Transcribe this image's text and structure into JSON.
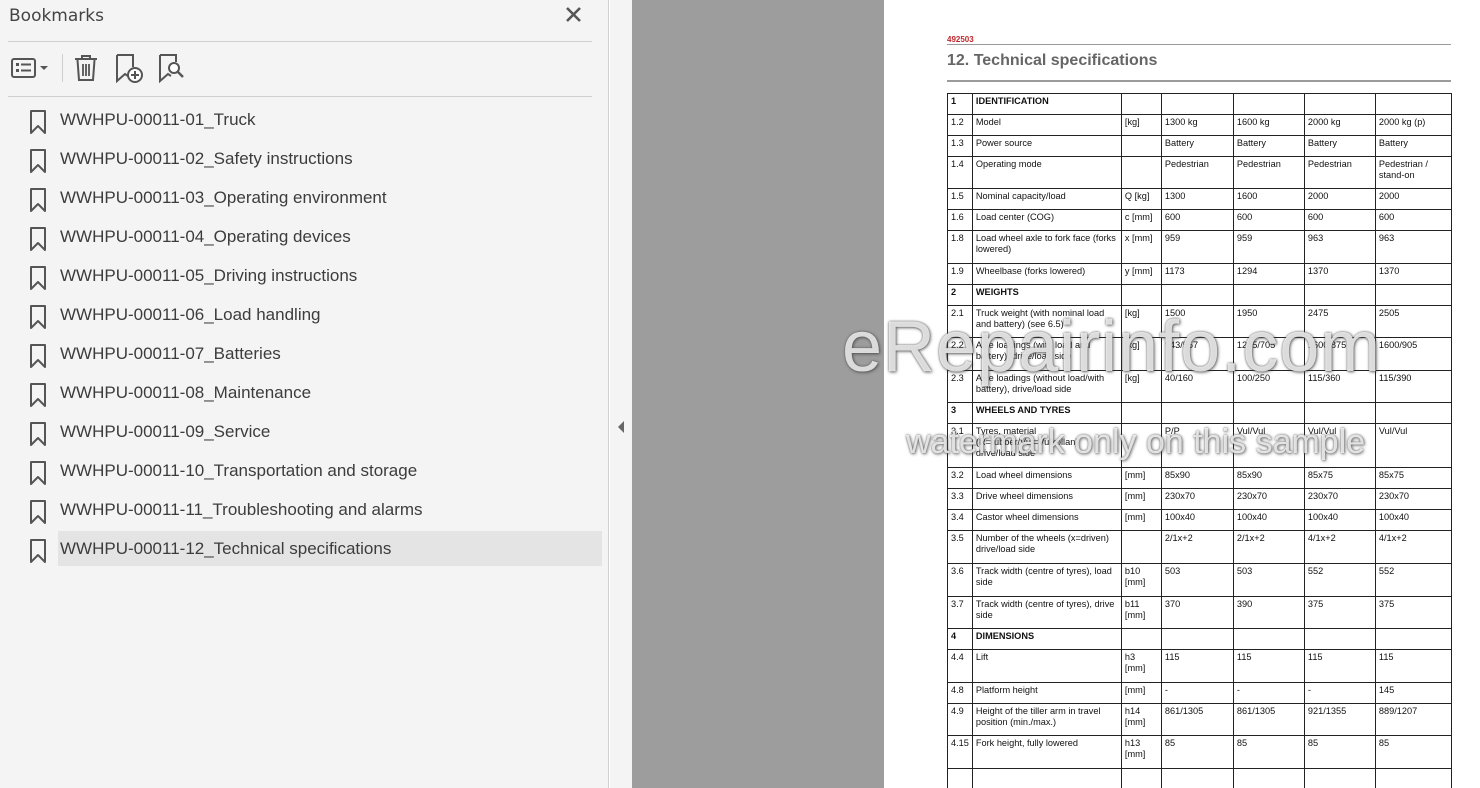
{
  "panel": {
    "title": "Bookmarks",
    "icons": {
      "close": "close-icon",
      "options": "bookmark-options-icon",
      "delete": "trash-icon",
      "add": "add-bookmark-icon",
      "find": "find-bookmark-icon",
      "bookmark": "bookmark-icon"
    },
    "bookmarks": [
      {
        "label": "WWHPU-00011-01_Truck"
      },
      {
        "label": "WWHPU-00011-02_Safety instructions"
      },
      {
        "label": "WWHPU-00011-03_Operating environment"
      },
      {
        "label": "WWHPU-00011-04_Operating devices"
      },
      {
        "label": "WWHPU-00011-05_Driving instructions"
      },
      {
        "label": "WWHPU-00011-06_Load handling"
      },
      {
        "label": "WWHPU-00011-07_Batteries"
      },
      {
        "label": "WWHPU-00011-08_Maintenance"
      },
      {
        "label": "WWHPU-00011-09_Service"
      },
      {
        "label": "WWHPU-00011-10_Transportation and storage"
      },
      {
        "label": "WWHPU-00011-11_Troubleshooting and alarms"
      },
      {
        "label": "WWHPU-00011-12_Technical specifications",
        "selected": true
      }
    ]
  },
  "document": {
    "code": "492503",
    "title": "12. Technical specifications",
    "rows": [
      {
        "section": true,
        "cells": [
          "1",
          "IDENTIFICATION",
          "",
          "",
          "",
          "",
          ""
        ]
      },
      {
        "cells": [
          "1.2",
          "Model",
          "[kg]",
          "1300 kg",
          "1600 kg",
          "2000 kg",
          "2000 kg (p)"
        ]
      },
      {
        "cells": [
          "1.3",
          "Power source",
          "",
          "Battery",
          "Battery",
          "Battery",
          "Battery"
        ]
      },
      {
        "cells": [
          "1.4",
          "Operating mode",
          "",
          "Pedestrian",
          "Pedestrian",
          "Pedestrian",
          "Pedestrian / stand-on"
        ]
      },
      {
        "cells": [
          "1.5",
          "Nominal capacity/load",
          "Q [kg]",
          "1300",
          "1600",
          "2000",
          "2000"
        ]
      },
      {
        "cells": [
          "1.6",
          "Load center (COG)",
          "c [mm]",
          "600",
          "600",
          "600",
          "600"
        ]
      },
      {
        "cells": [
          "1.8",
          "Load wheel axle to fork face (forks lowered)",
          "x [mm]",
          "959",
          "959",
          "963",
          "963"
        ]
      },
      {
        "cells": [
          "1.9",
          "Wheelbase (forks lowered)",
          "y [mm]",
          "1173",
          "1294",
          "1370",
          "1370"
        ]
      },
      {
        "section": true,
        "cells": [
          "2",
          "WEIGHTS",
          "",
          "",
          "",
          "",
          ""
        ]
      },
      {
        "cells": [
          "2.1",
          "Truck weight (with nominal load and battery) (see 6.5)",
          "[kg]",
          "1500",
          "1950",
          "2475",
          "2505"
        ]
      },
      {
        "cells": [
          "2.2",
          "Axle loadings (with load and battery), drive/load side",
          "[kg]",
          "943/557",
          "1245/705",
          "1600/875",
          "1600/905"
        ]
      },
      {
        "cells": [
          "2.3",
          "Axle loadings (without load/with battery), drive/load side",
          "[kg]",
          "40/160",
          "100/250",
          "115/360",
          "115/390"
        ]
      },
      {
        "section": true,
        "cells": [
          "3",
          "WHEELS AND TYRES",
          "",
          "",
          "",
          "",
          ""
        ]
      },
      {
        "cells": [
          "3.1",
          "Tyres, material (R=rubber/Vul=Vulkollan) drive/load side",
          "",
          "P/P",
          "Vul/Vul",
          "Vul/Vul",
          "Vul/Vul"
        ]
      },
      {
        "cells": [
          "3.2",
          "Load wheel dimensions",
          "[mm]",
          "85x90",
          "85x90",
          "85x75",
          "85x75"
        ]
      },
      {
        "cells": [
          "3.3",
          "Drive wheel dimensions",
          "[mm]",
          "230x70",
          "230x70",
          "230x70",
          "230x70"
        ]
      },
      {
        "cells": [
          "3.4",
          "Castor wheel dimensions",
          "[mm]",
          "100x40",
          "100x40",
          "100x40",
          "100x40"
        ]
      },
      {
        "cells": [
          "3.5",
          "Number of the wheels (x=driven) drive/load side",
          "",
          "2/1x+2",
          "2/1x+2",
          "4/1x+2",
          "4/1x+2"
        ]
      },
      {
        "cells": [
          "3.6",
          "Track width (centre of tyres), load side",
          "b10 [mm]",
          "503",
          "503",
          "552",
          "552"
        ]
      },
      {
        "cells": [
          "3.7",
          "Track width (centre of tyres), drive side",
          "b11 [mm]",
          "370",
          "390",
          "375",
          "375"
        ]
      },
      {
        "section": true,
        "cells": [
          "4",
          "DIMENSIONS",
          "",
          "",
          "",
          "",
          ""
        ]
      },
      {
        "cells": [
          "4.4",
          "Lift",
          "h3 [mm]",
          "115",
          "115",
          "115",
          "115"
        ]
      },
      {
        "cells": [
          "4.8",
          "Platform height",
          "[mm]",
          "-",
          "-",
          "-",
          "145"
        ]
      },
      {
        "cells": [
          "4.9",
          "Height of the tiller arm in travel position (min./max.)",
          "h14 [mm]",
          "861/1305",
          "861/1305",
          "921/1355",
          "889/1207"
        ]
      },
      {
        "cells": [
          "4.15",
          "Fork height, fully lowered",
          "h13 [mm]",
          "85",
          "85",
          "85",
          "85"
        ]
      },
      {
        "cells": [
          "",
          "",
          "",
          "",
          "",
          "",
          ""
        ]
      }
    ]
  },
  "watermark": {
    "line1": "eRepairinfo.com",
    "line2": "watermark only on this sample"
  }
}
